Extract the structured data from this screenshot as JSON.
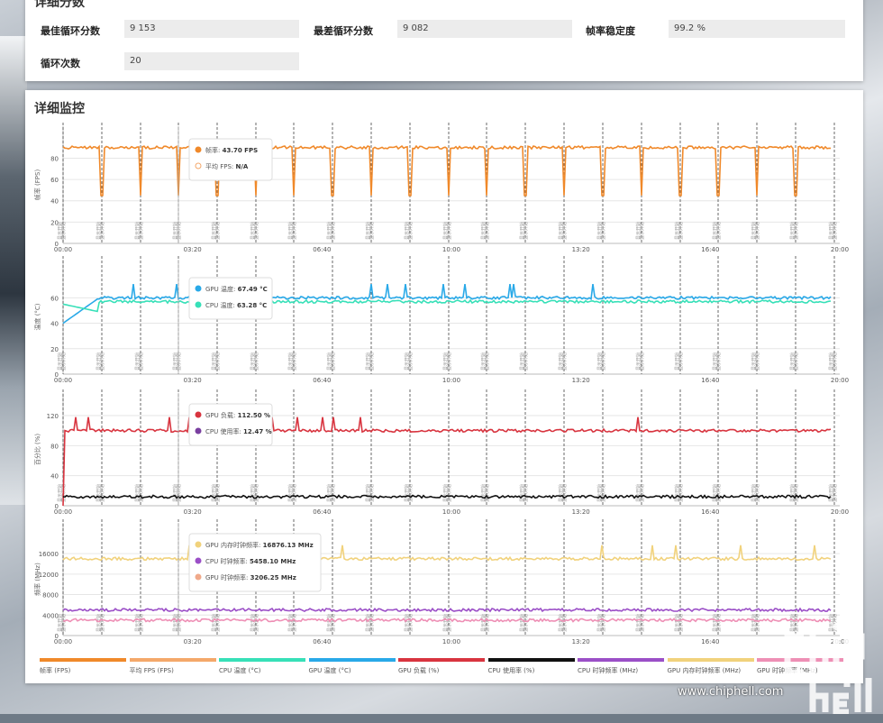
{
  "detail_scores": {
    "title": "详细分数",
    "rows": [
      {
        "label": "最佳循环分数",
        "value": "9 153"
      },
      {
        "label": "最差循环分数",
        "value": "9 082"
      },
      {
        "label": "帧率稳定度",
        "value": "99.2 %"
      },
      {
        "label": "循环次数",
        "value": "20"
      }
    ]
  },
  "monitor": {
    "title": "详细监控"
  },
  "x_ticks": [
    "00:00",
    "03:20",
    "06:40",
    "10:00",
    "13:20",
    "16:40",
    "20:00"
  ],
  "marker_label": "显示开始",
  "chart_data": [
    {
      "type": "line",
      "ylabel": "帧率 (FPS)",
      "ylim": [
        0,
        110
      ],
      "yticks": [
        0,
        20,
        40,
        60,
        80
      ],
      "series": [
        {
          "name": "帧率 (FPS)",
          "color": "#f0892a",
          "base": 90,
          "dip": 45
        }
      ],
      "tooltip": [
        {
          "label": "帧率: ",
          "value": "43.70 FPS",
          "color": "#f0892a",
          "hollow": false
        },
        {
          "label": "平均 FPS: ",
          "value": "N/A",
          "color": "#f4a86a",
          "hollow": true
        }
      ]
    },
    {
      "type": "line",
      "ylabel": "温度 (°C)",
      "ylim": [
        0,
        90
      ],
      "yticks": [
        0,
        20,
        40,
        60
      ],
      "series": [
        {
          "name": "GPU 温度 (°C)",
          "color": "#29a9e8",
          "base": 60
        },
        {
          "name": "CPU 温度 (°C)",
          "color": "#37e0b8",
          "base": 57
        }
      ],
      "tooltip": [
        {
          "label": "GPU 温度: ",
          "value": "67.49 °C",
          "color": "#29a9e8",
          "hollow": false
        },
        {
          "label": "CPU 温度: ",
          "value": "63.28 °C",
          "color": "#37e0b8",
          "hollow": false
        }
      ]
    },
    {
      "type": "line",
      "ylabel": "百分比 (%)",
      "ylim": [
        0,
        150
      ],
      "yticks": [
        0,
        40,
        80,
        120
      ],
      "series": [
        {
          "name": "GPU 负载 (%)",
          "color": "#d8343f",
          "base": 100
        },
        {
          "name": "CPU 使用率 (%)",
          "color": "#111111",
          "base": 12
        }
      ],
      "tooltip": [
        {
          "label": "GPU 负载: ",
          "value": "112.50 %",
          "color": "#d8343f",
          "hollow": false
        },
        {
          "label": "CPU 使用率: ",
          "value": "12.47 %",
          "color": "#7a3fa0",
          "hollow": false
        }
      ]
    },
    {
      "type": "line",
      "ylabel": "频率 (MHz)",
      "ylim": [
        0,
        22000
      ],
      "yticks": [
        0,
        4000,
        8000,
        12000,
        16000
      ],
      "series": [
        {
          "name": "GPU 内存时钟频率 (MHz)",
          "color": "#f1d27c",
          "base": 15000
        },
        {
          "name": "CPU 时钟频率 (MHz)",
          "color": "#9b4fc7",
          "base": 5000
        },
        {
          "name": "GPU 时钟频率 (MHz)",
          "color": "#ee8fb5",
          "base": 3000
        }
      ],
      "tooltip": [
        {
          "label": "GPU 内存时钟频率: ",
          "value": "16876.13 MHz",
          "color": "#f1d27c",
          "hollow": false
        },
        {
          "label": "CPU 时钟频率: ",
          "value": "5458.10 MHz",
          "color": "#9b4fc7",
          "hollow": false
        },
        {
          "label": "GPU 时钟频率: ",
          "value": "3206.25 MHz",
          "color": "#f0a98a",
          "hollow": false
        }
      ]
    }
  ],
  "legend": [
    {
      "label": "帧率 (FPS)",
      "color": "#f0892a"
    },
    {
      "label": "平均 FPS (FPS)",
      "color": "#f4a86a"
    },
    {
      "label": "CPU 温度 (°C)",
      "color": "#37e0b8"
    },
    {
      "label": "GPU 温度 (°C)",
      "color": "#29a9e8"
    },
    {
      "label": "GPU 负载 (%)",
      "color": "#d8343f"
    },
    {
      "label": "CPU 使用率 (%)",
      "color": "#111111"
    },
    {
      "label": "CPU 时钟频率 (MHz)",
      "color": "#9b4fc7"
    },
    {
      "label": "GPU 内存时钟频率 (MHz)",
      "color": "#f1d27c"
    },
    {
      "label": "GPU 时钟频率 (MHz)",
      "color": "#ee8fb5"
    }
  ],
  "watermark": {
    "logo_text": "chip hell",
    "url": "www.chiphell.com"
  }
}
